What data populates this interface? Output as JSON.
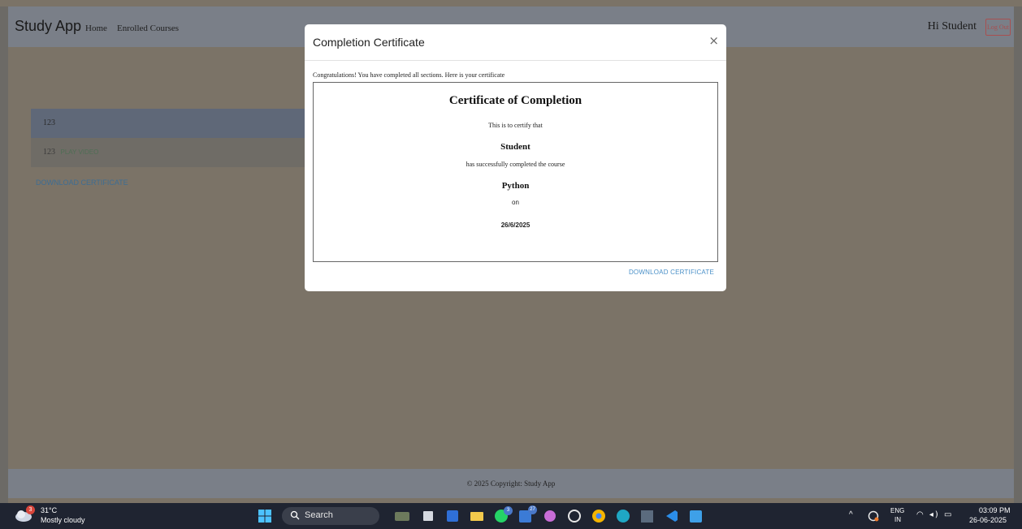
{
  "navbar": {
    "brand": "Study App",
    "links": [
      "Home",
      "Enrolled Courses"
    ],
    "greeting": "Hi Student",
    "logout_label": "Log Out"
  },
  "sections": [
    {
      "name": "123"
    },
    {
      "name": "123",
      "action": "PLAY VIDEO"
    }
  ],
  "download_label": "DOWNLOAD CERTIFICATE",
  "modal": {
    "title": "Completion Certificate",
    "close_symbol": "×",
    "intro": "Congratulations! You have completed all sections. Here is your certificate",
    "certificate": {
      "title": "Certificate of Completion",
      "certify_text": "This is to certify that",
      "student": "Student",
      "completed_text": "has successfully completed the course",
      "course": "Python",
      "on_text": "on",
      "date": "26/6/2025"
    },
    "download_label": "DOWNLOAD CERTIFICATE"
  },
  "footer": {
    "text": "© 2025 Copyright: Study App"
  },
  "taskbar": {
    "weather_badge": "3",
    "temperature": "31°C",
    "weather": "Mostly cloudy",
    "search_placeholder": "Search",
    "whatsapp_badge": "3",
    "linkedin_badge": "27",
    "lang_primary": "ENG",
    "lang_secondary": "IN",
    "time": "03:09 PM",
    "date": "26-06-2025"
  },
  "colors": {
    "overlay": "#7b7367",
    "navbar": "#7a7f88",
    "accent_link": "#4a90c8",
    "logout": "#a85050",
    "taskbar": "#1f2431"
  },
  "icons": [
    "weather-cloud-icon",
    "windows-start-icon",
    "search-icon",
    "close-icon",
    "chevron-up-icon",
    "wifi-icon",
    "volume-icon",
    "battery-icon"
  ]
}
